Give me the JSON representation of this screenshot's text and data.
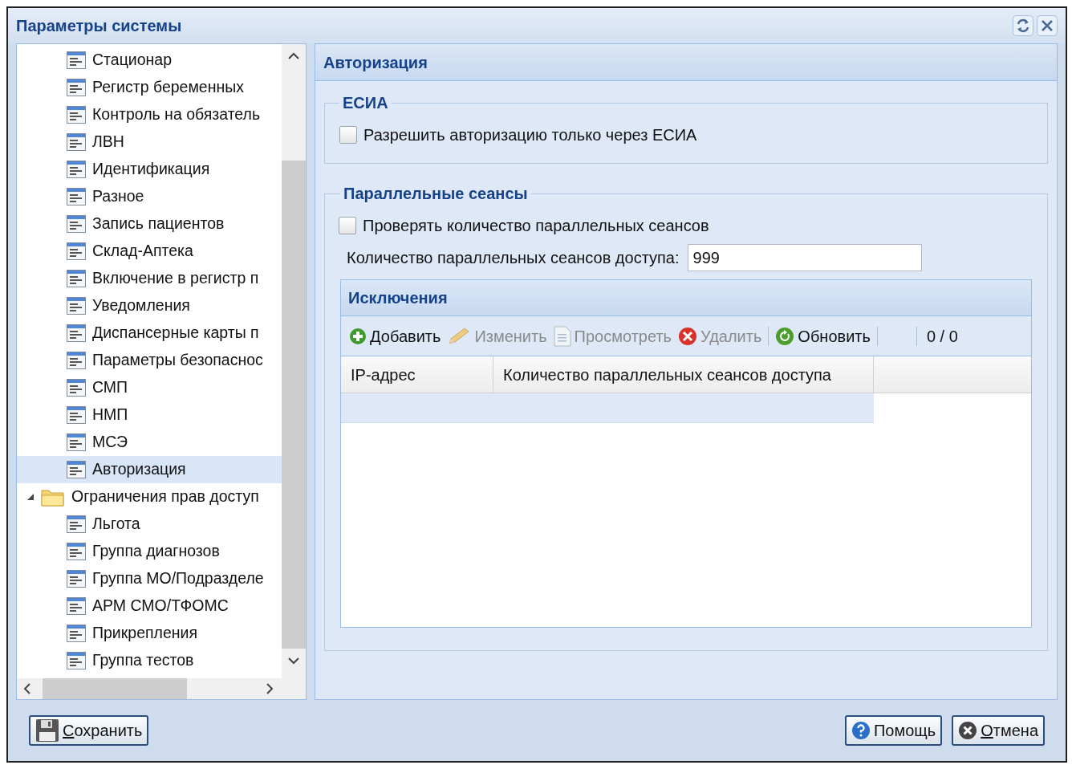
{
  "window": {
    "title": "Параметры системы"
  },
  "tree": {
    "items": [
      {
        "kind": "leaf",
        "label": "Стационар",
        "selected": false
      },
      {
        "kind": "leaf",
        "label": "Регистр беременных",
        "selected": false
      },
      {
        "kind": "leaf",
        "label": "Контроль на обязатель",
        "selected": false
      },
      {
        "kind": "leaf",
        "label": "ЛВН",
        "selected": false
      },
      {
        "kind": "leaf",
        "label": "Идентификация",
        "selected": false
      },
      {
        "kind": "leaf",
        "label": "Разное",
        "selected": false
      },
      {
        "kind": "leaf",
        "label": "Запись пациентов",
        "selected": false
      },
      {
        "kind": "leaf",
        "label": "Склад-Аптека",
        "selected": false
      },
      {
        "kind": "leaf",
        "label": "Включение в регистр п",
        "selected": false
      },
      {
        "kind": "leaf",
        "label": "Уведомления",
        "selected": false
      },
      {
        "kind": "leaf",
        "label": "Диспансерные карты п",
        "selected": false
      },
      {
        "kind": "leaf",
        "label": "Параметры безопаснос",
        "selected": false
      },
      {
        "kind": "leaf",
        "label": "СМП",
        "selected": false
      },
      {
        "kind": "leaf",
        "label": "НМП",
        "selected": false
      },
      {
        "kind": "leaf",
        "label": "МСЭ",
        "selected": false
      },
      {
        "kind": "leaf",
        "label": "Авторизация",
        "selected": true
      },
      {
        "kind": "folder",
        "label": "Ограничения прав доступ",
        "selected": false,
        "expanded": true,
        "children": [
          {
            "kind": "leaf",
            "label": "Льгота",
            "selected": false
          },
          {
            "kind": "leaf",
            "label": "Группа диагнозов",
            "selected": false
          },
          {
            "kind": "leaf",
            "label": "Группа МО/Подразделе",
            "selected": false
          },
          {
            "kind": "leaf",
            "label": "АРМ СМО/ТФОМС",
            "selected": false
          },
          {
            "kind": "leaf",
            "label": "Прикрепления",
            "selected": false
          },
          {
            "kind": "leaf",
            "label": "Группа тестов",
            "selected": false
          }
        ]
      }
    ]
  },
  "panel": {
    "title": "Авторизация",
    "esia": {
      "legend": "ЕСИА",
      "checkbox": {
        "label": "Разрешить авторизацию только через ЕСИА",
        "checked": false
      }
    },
    "sessions": {
      "legend": "Параллельные сеансы",
      "checkbox": {
        "label": "Проверять количество параллельных сеансов",
        "checked": false
      },
      "field": {
        "label": "Количество параллельных сеансов доступа:",
        "value": "999"
      },
      "exceptions": {
        "title": "Исключения",
        "toolbar": [
          {
            "kind": "button",
            "label": "Добавить",
            "disabled": false
          },
          {
            "kind": "button",
            "label": "Изменить",
            "disabled": true
          },
          {
            "kind": "button",
            "label": "Просмотреть",
            "disabled": true
          },
          {
            "kind": "button",
            "label": "Удалить",
            "disabled": true
          },
          {
            "kind": "separator"
          },
          {
            "kind": "button",
            "label": "Обновить",
            "disabled": false
          },
          {
            "kind": "separator"
          },
          {
            "kind": "separator"
          },
          {
            "kind": "pager",
            "label": "0 / 0"
          }
        ],
        "columns": [
          "IP-адрес",
          "Количество параллельных сеансов доступа"
        ],
        "rows": [
          {
            "selected": true
          }
        ]
      }
    }
  },
  "buttons": [
    {
      "label": "Сохранить",
      "mnemonic": true
    },
    {
      "label": "Помощь",
      "mnemonic": false
    },
    {
      "label": "Отмена",
      "mnemonic": true
    }
  ]
}
